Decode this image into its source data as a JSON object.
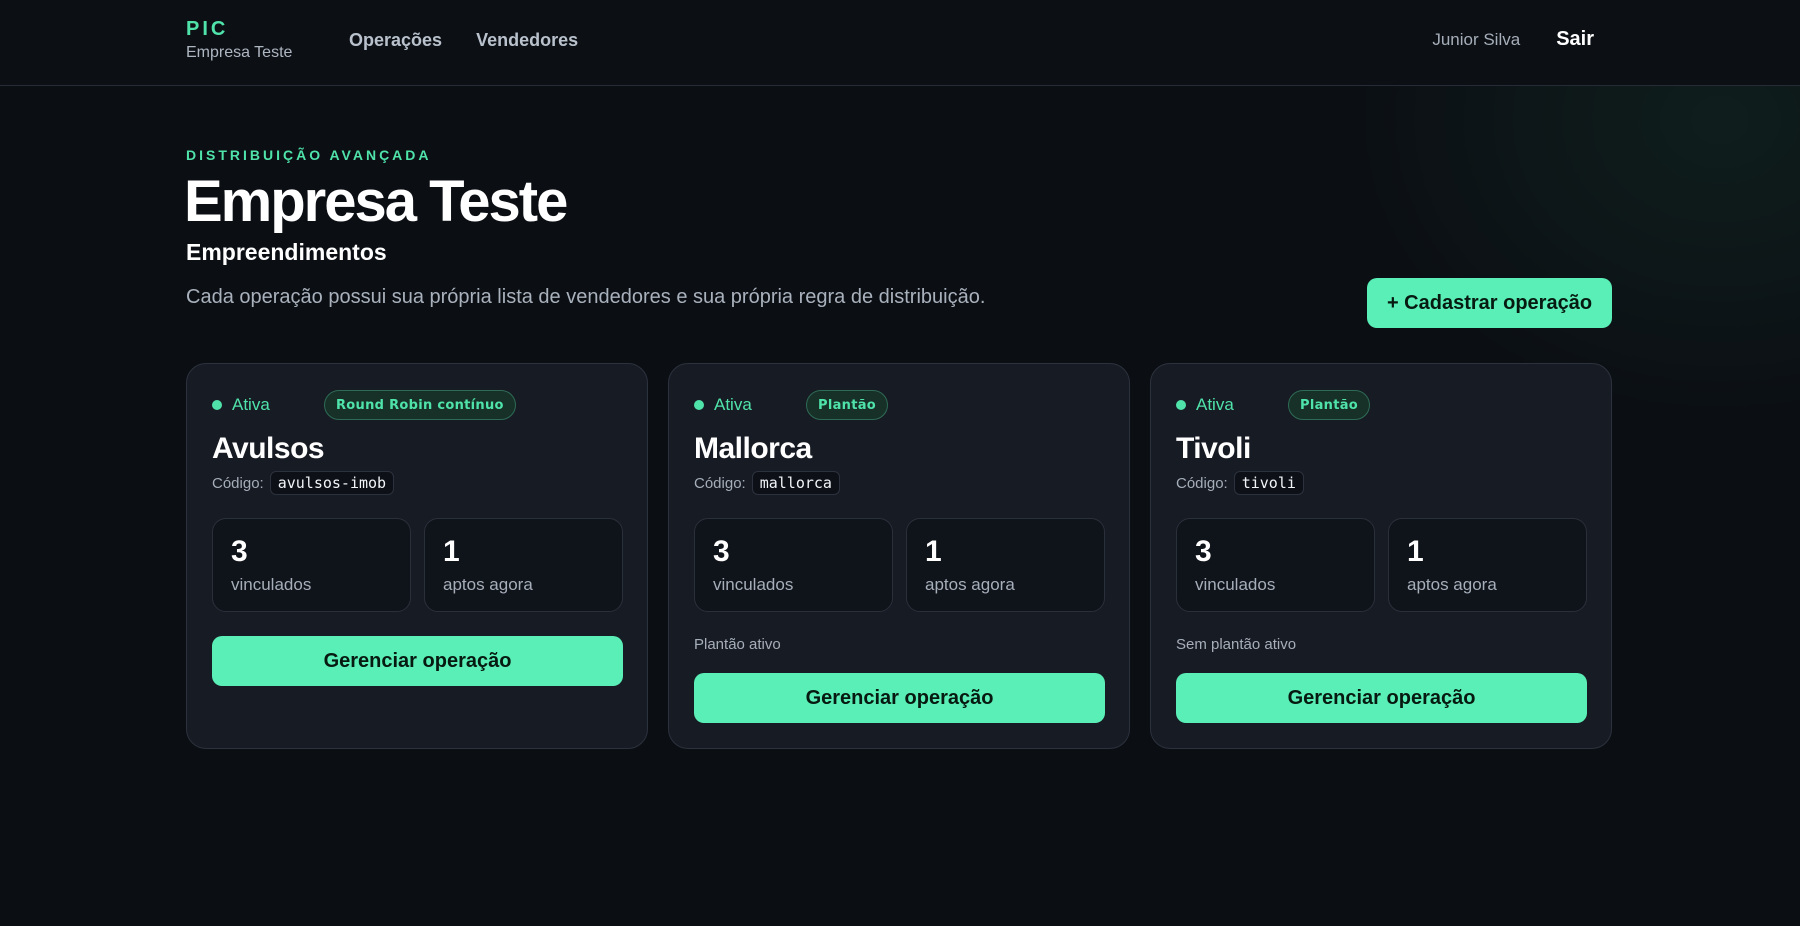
{
  "header": {
    "brand_code": "PIC",
    "brand_company": "Empresa Teste",
    "nav": [
      "Operações",
      "Vendedores"
    ],
    "user_name": "Junior Silva",
    "logout_label": "Sair"
  },
  "hero": {
    "eyebrow": "DISTRIBUIÇÃO AVANÇADA",
    "title": "Empresa Teste",
    "section_title": "Empreendimentos",
    "description": "Cada operação possui sua própria lista de vendedores e sua própria regra de distribuição.",
    "cta_label": "+ Cadastrar operação"
  },
  "operations": [
    {
      "status": "Ativa",
      "rule": "Round Robin contínuo",
      "name": "Avulsos",
      "code_label": "Código:",
      "code": "avulsos-imob",
      "linked_count": "3",
      "linked_label": "vinculados",
      "available_count": "1",
      "available_label": "aptos agora",
      "shift_text": "",
      "button_label": "Gerenciar operação"
    },
    {
      "status": "Ativa",
      "rule": "Plantão",
      "name": "Mallorca",
      "code_label": "Código:",
      "code": "mallorca",
      "linked_count": "3",
      "linked_label": "vinculados",
      "available_count": "1",
      "available_label": "aptos agora",
      "shift_text": "Plantão ativo",
      "button_label": "Gerenciar operação"
    },
    {
      "status": "Ativa",
      "rule": "Plantão",
      "name": "Tivoli",
      "code_label": "Código:",
      "code": "tivoli",
      "linked_count": "3",
      "linked_label": "vinculados",
      "available_count": "1",
      "available_label": "aptos agora",
      "shift_text": "Sem plantão ativo",
      "button_label": "Gerenciar operação"
    }
  ],
  "colors": {
    "accent": "#5aefb6",
    "accent_text": "#4fe3aa",
    "background": "#0b0f14",
    "card": "#171b24"
  }
}
